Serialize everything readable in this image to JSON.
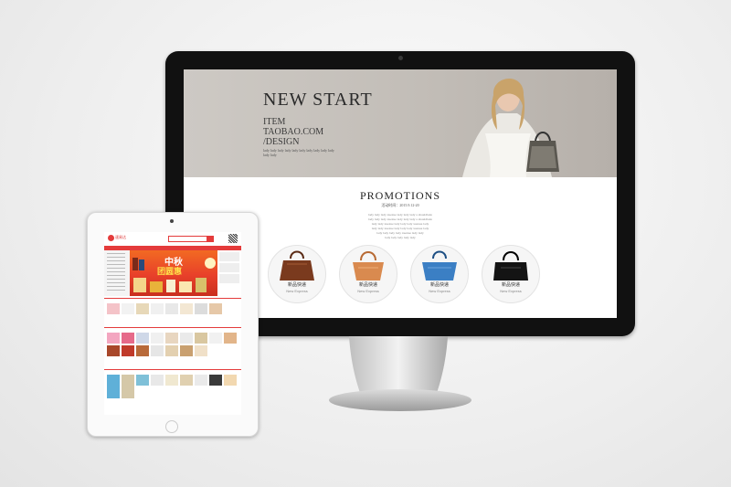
{
  "monitor": {
    "hero": {
      "title": "NEW START",
      "subtitle_lines": [
        "ITEM",
        "TAOBAO.COM",
        "/DESIGN"
      ],
      "small_text": "lady lady lady lady lady lady lady lady lady lady lady lady"
    },
    "promotions": {
      "title": "PROMOTIONS",
      "date": "活动时间：2015.9.12-20",
      "body_lines": [
        "lady lady lady xuexue lady lady lady a shouldlade",
        "lady lady lady xuexue lady lady lady a shouldlade",
        "lady lady xuexue lady lady lady xuexue lady",
        "lady lady xuexue lady lady lady xuexue lady",
        "lady lady lady lady xuexue lady lady",
        "lady lady lady lady lady"
      ]
    },
    "products": [
      {
        "label": "新品快递",
        "sublabel": "New Express",
        "color": "#7a3a1e",
        "icon": "brown-handbag-icon"
      },
      {
        "label": "新品快递",
        "sublabel": "New Express",
        "color": "#d98a4f",
        "icon": "orange-handbag-icon"
      },
      {
        "label": "新品快递",
        "sublabel": "New Express",
        "color": "#3b7fc4",
        "icon": "blue-handbag-icon"
      },
      {
        "label": "新品快递",
        "sublabel": "New Express",
        "color": "#141414",
        "icon": "black-handbag-icon"
      }
    ]
  },
  "tablet": {
    "brand": "速易达",
    "banner_line1": "中秋",
    "banner_line2": "团圆惠"
  },
  "colors": {
    "accent": "#e43b3b",
    "hero_bg": "#c4c0bb"
  }
}
